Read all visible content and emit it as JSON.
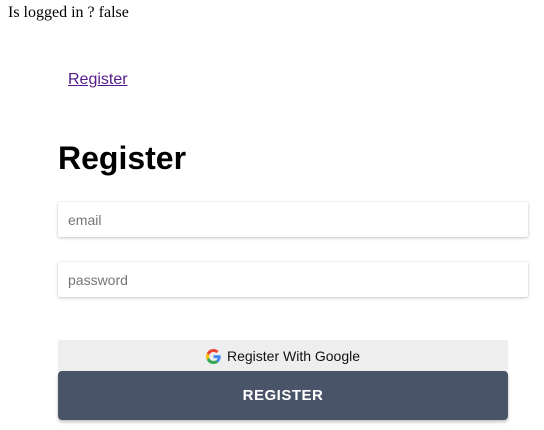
{
  "status": {
    "text": "Is logged in ? false"
  },
  "nav": {
    "register_link": "Register"
  },
  "form": {
    "title": "Register",
    "email": {
      "value": "",
      "placeholder": "email"
    },
    "password": {
      "value": "",
      "placeholder": "password"
    },
    "google_button_label": "Register With Google",
    "google_icon": "google-g-icon",
    "submit_label": "REGISTER"
  },
  "colors": {
    "link": "#551a8b",
    "submit_bg": "#4a5469",
    "google_bg": "#eeeeee"
  }
}
